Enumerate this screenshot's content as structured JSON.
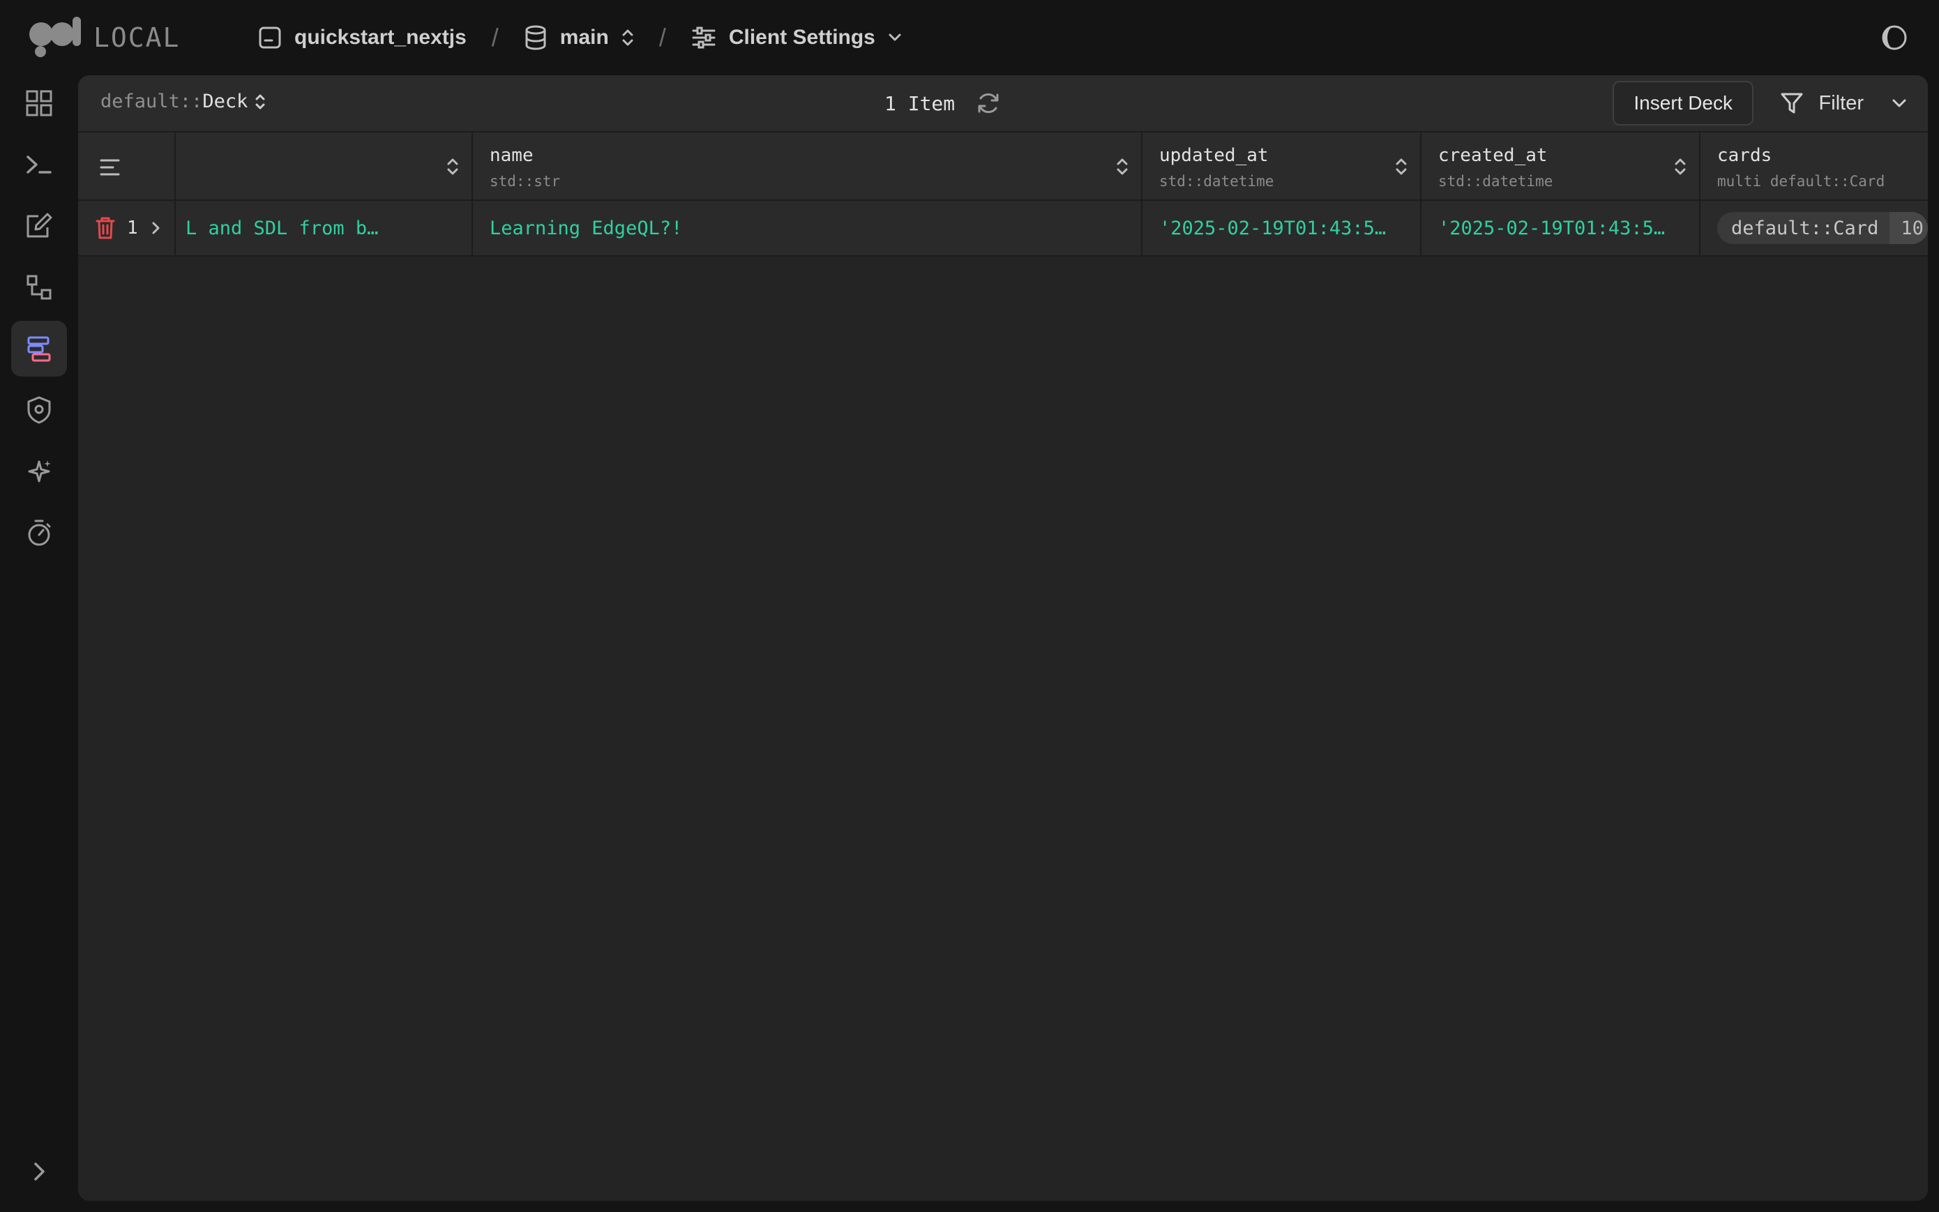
{
  "app": {
    "logo_text": "LOCAL"
  },
  "breadcrumbs": {
    "instance": "quickstart_nextjs",
    "separator": "/",
    "branch": "main",
    "settings": "Client Settings"
  },
  "sidebar": {
    "items": [
      {
        "name": "dashboard-icon"
      },
      {
        "name": "repl-icon"
      },
      {
        "name": "editor-icon"
      },
      {
        "name": "schema-icon"
      },
      {
        "name": "data-explorer-icon",
        "active": true
      },
      {
        "name": "auth-icon"
      },
      {
        "name": "ai-icon"
      },
      {
        "name": "perf-stats-icon"
      }
    ],
    "expand": "chevron-right-icon"
  },
  "panel": {
    "object_namespace": "default::",
    "object_type": "Deck",
    "item_count": "1 Item",
    "insert_label": "Insert Deck",
    "filter_label": "Filter"
  },
  "grid": {
    "columns": [
      {
        "name": "",
        "type": ""
      },
      {
        "name": "name",
        "type": "std::str"
      },
      {
        "name": "updated_at",
        "type": "std::datetime"
      },
      {
        "name": "created_at",
        "type": "std::datetime"
      },
      {
        "name": "cards",
        "type": "multi default::Card"
      }
    ],
    "rows": [
      {
        "index": "1",
        "c0": "L and SDL from b…",
        "name": "Learning EdgeQL?!",
        "updated_at": "'2025-02-19T01:43:5…",
        "created_at": "'2025-02-19T01:43:5…",
        "cards_label": "default::Card",
        "cards_count": "10"
      }
    ]
  },
  "colors": {
    "accent_green": "#30d0a0",
    "delete_red": "#e5484d",
    "active_icon_blue": "#7b8cff",
    "active_icon_pink": "#ff6b8a"
  }
}
